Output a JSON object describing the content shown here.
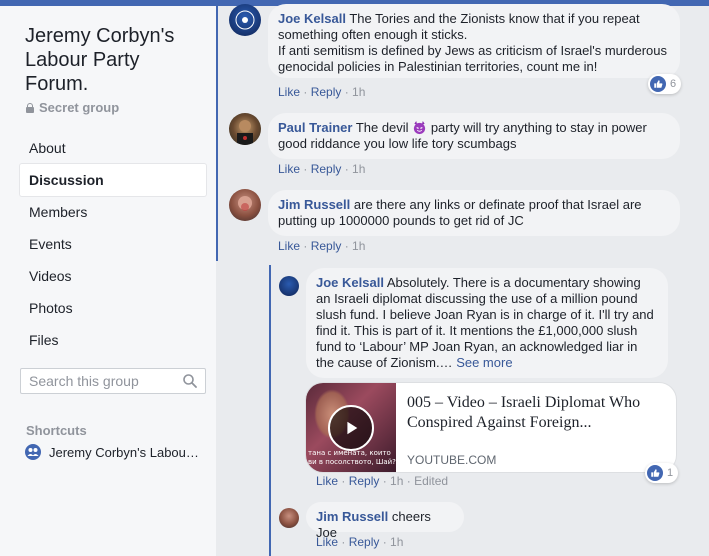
{
  "group": {
    "title": "Jeremy Corbyn's Labour Party Forum.",
    "privacy": "Secret group"
  },
  "nav": [
    {
      "label": "About",
      "active": false
    },
    {
      "label": "Discussion",
      "active": true
    },
    {
      "label": "Members",
      "active": false
    },
    {
      "label": "Events",
      "active": false
    },
    {
      "label": "Videos",
      "active": false
    },
    {
      "label": "Photos",
      "active": false
    },
    {
      "label": "Files",
      "active": false
    }
  ],
  "search": {
    "placeholder": "Search this group"
  },
  "shortcuts": {
    "title": "Shortcuts",
    "item": "Jeremy Corbyn's Labour Party Forum."
  },
  "actions": {
    "like": "Like",
    "reply": "Reply",
    "edited": "Edited"
  },
  "comments": [
    {
      "author": "Joe Kelsall",
      "text": "The Tories and the Zionists know that if you repeat something often enough it sticks.",
      "text2": "If anti semitism is defined by Jews as criticism of Israel's murderous genocidal policies in Palestinian territories, count me in!",
      "time": "1h",
      "likes": "6"
    },
    {
      "author": "Paul Trainer",
      "text_before": "The devil",
      "emoji": "devil-emoji",
      "text_after": "party will try anything to stay in power good riddance you low life tory scumbags",
      "time": "1h"
    },
    {
      "author": "Jim Russell",
      "text": "are there any links or definate proof that Israel are putting up 1000000 pounds to get rid of JC",
      "time": "1h"
    }
  ],
  "replies": [
    {
      "author": "Joe Kelsall",
      "text": "Absolutely. There is a documentary showing an Israeli diplomat discussing the use of a million pound slush fund. I believe Joan Ryan is in charge of it. I'll try and find it. This is part of it. It mentions the £1,000,000 slush fund to ‘Labour’ MP Joan Ryan, an acknowledged liar in the cause of Zionism.…",
      "see_more": "See more",
      "time": "1h",
      "likes": "1",
      "link": {
        "title": "005 – Video – Israeli Diplomat Who Conspired Against Foreign...",
        "source": "YOUTUBE.COM",
        "thumb_caption": "тана с имената, които ви в посолството, Шай?"
      }
    },
    {
      "author": "Jim Russell",
      "text": "cheers Joe",
      "time": "1h"
    }
  ],
  "colors": {
    "accent": "#4267b2",
    "link": "#385898",
    "muted": "#90949c",
    "bubble": "#f2f3f5"
  }
}
